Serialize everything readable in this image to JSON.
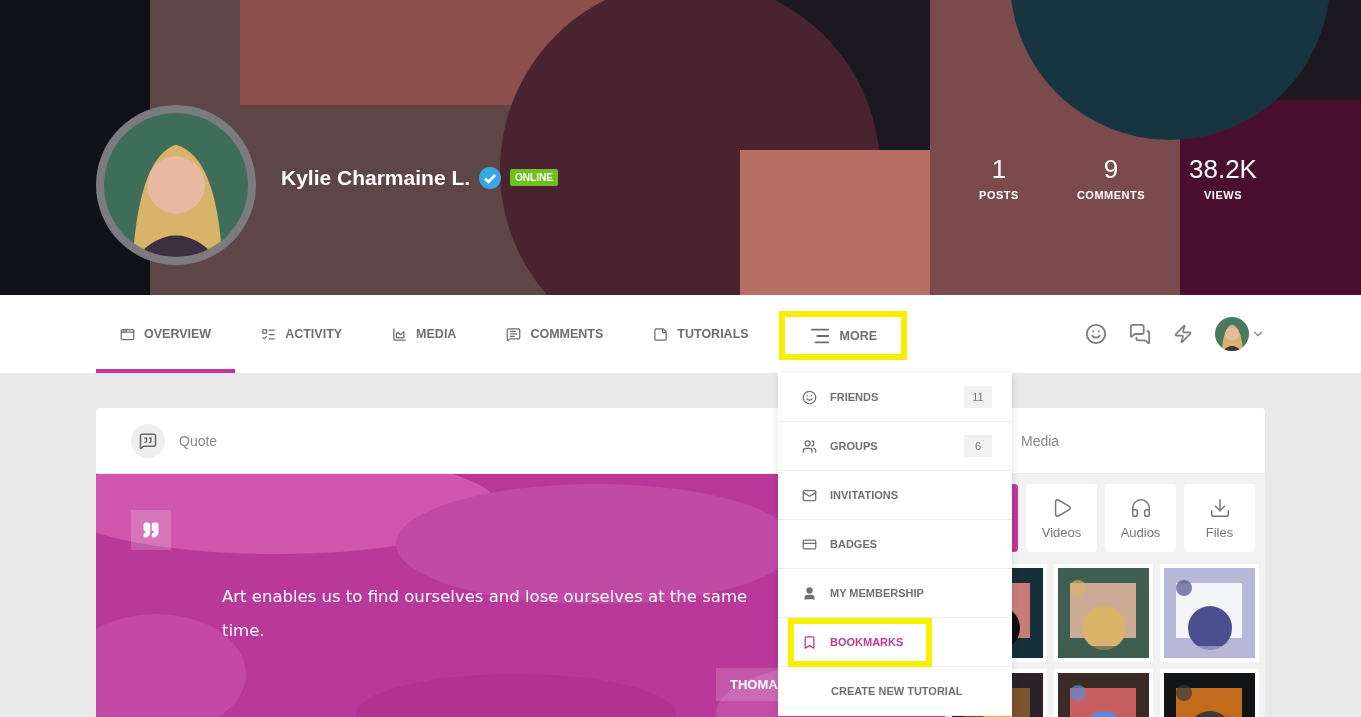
{
  "profile": {
    "name": "Kylie Charmaine L.",
    "verified": true,
    "status": "ONLINE"
  },
  "stats": [
    {
      "value": "1",
      "label": "POSTS"
    },
    {
      "value": "9",
      "label": "COMMENTS"
    },
    {
      "value": "38.2K",
      "label": "VIEWS"
    }
  ],
  "tabs": [
    {
      "kind": "overview",
      "label": "OVERVIEW",
      "selected": true,
      "highlighted": false
    },
    {
      "kind": "activity",
      "label": "ACTIVITY",
      "selected": false,
      "highlighted": false
    },
    {
      "kind": "media",
      "label": "MEDIA",
      "selected": false,
      "highlighted": false
    },
    {
      "kind": "comments",
      "label": "COMMENTS",
      "selected": false,
      "highlighted": false
    },
    {
      "kind": "tutorials",
      "label": "TUTORIALS",
      "selected": false,
      "highlighted": false
    },
    {
      "kind": "more",
      "label": "MORE",
      "selected": false,
      "highlighted": true
    }
  ],
  "more_menu": [
    {
      "kind": "friends",
      "label": "FRIENDS",
      "count": "11",
      "selected": false,
      "highlighted": false
    },
    {
      "kind": "groups",
      "label": "GROUPS",
      "count": "6",
      "selected": false,
      "highlighted": false
    },
    {
      "kind": "invitations",
      "label": "INVITATIONS",
      "selected": false,
      "highlighted": false
    },
    {
      "kind": "badges",
      "label": "BADGES",
      "selected": false,
      "highlighted": false
    },
    {
      "kind": "membership",
      "label": "MY MEMBERSHIP",
      "selected": false,
      "highlighted": false
    },
    {
      "kind": "bookmarks",
      "label": "BOOKMARKS",
      "selected": true,
      "highlighted": true
    },
    {
      "kind": "create",
      "label": "CREATE NEW TUTORIAL",
      "selected": false,
      "highlighted": false
    }
  ],
  "composer": {
    "quote_tab": "Quote",
    "media_tab": "Media"
  },
  "quote": {
    "text": "Art enables us to find ourselves and lose ourselves at the same time.",
    "author": "THOMA"
  },
  "media_filters": [
    {
      "kind": "photos",
      "selected": true
    },
    {
      "kind": "videos",
      "label": "Videos",
      "selected": false
    },
    {
      "kind": "audios",
      "label": "Audios",
      "selected": false
    },
    {
      "kind": "files",
      "label": "Files",
      "selected": false
    }
  ]
}
